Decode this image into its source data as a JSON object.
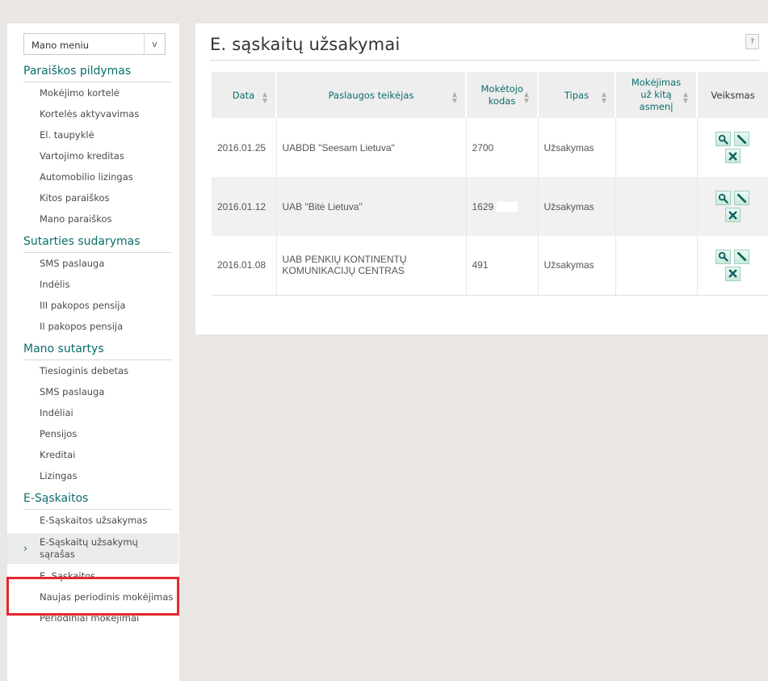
{
  "sidebar": {
    "menu_select": {
      "value": "Mano meniu",
      "arrow": "v"
    },
    "sections": [
      {
        "title": "Paraiškos pildymas",
        "items": [
          "Mokėjimo kortelė",
          "Kortelės aktyvavimas",
          "El. taupyklė",
          "Vartojimo kreditas",
          "Automobilio lizingas",
          "Kitos paraiškos",
          "Mano paraiškos"
        ]
      },
      {
        "title": "Sutarties sudarymas",
        "items": [
          "SMS paslauga",
          "Indėlis",
          "III pakopos pensija",
          "II pakopos pensija"
        ]
      },
      {
        "title": "Mano sutartys",
        "items": [
          "Tiesioginis debetas",
          "SMS paslauga",
          "Indėliai",
          "Pensijos",
          "Kreditai",
          "Lizingas"
        ]
      },
      {
        "title": "E-Sąskaitos",
        "items": [
          "E-Sąskaitos užsakymas",
          "E-Sąskaitų užsakymų sąrašas",
          "E. Sąskaitos",
          "Naujas periodinis mokėjimas",
          "Periodiniai mokėjimai"
        ],
        "active_index": 1
      }
    ],
    "active_arrow": "›",
    "highlight_color": "#e5282e"
  },
  "main": {
    "title": "E. sąskaitų užsakymai",
    "help": "?",
    "columns": [
      "Data",
      "Paslaugos teikėjas",
      "Mokėtojo kodas",
      "Tipas",
      "Mokėjimas už kitą asmenį",
      "Veiksmas"
    ],
    "rows": [
      {
        "date": "2016.01.25",
        "provider": "UABDB \"Seesam Lietuva\"",
        "code": "2700",
        "type": "Užsakymas",
        "other": ""
      },
      {
        "date": "2016.01.12",
        "provider": "UAB \"Bitė Lietuva\"",
        "code": "1629",
        "type": "Užsakymas",
        "other": ""
      },
      {
        "date": "2016.01.08",
        "provider": "UAB PENKIŲ KONTINENTŲ KOMUNIKACIJŲ CENTRAS",
        "code": "491",
        "type": "Užsakymas",
        "other": ""
      }
    ],
    "action_icons": [
      "search-icon",
      "edit-icon",
      "delete-icon"
    ]
  },
  "colors": {
    "accent": "#0a6e6a",
    "background": "#e9e6e3",
    "highlight": "#e5282e"
  }
}
